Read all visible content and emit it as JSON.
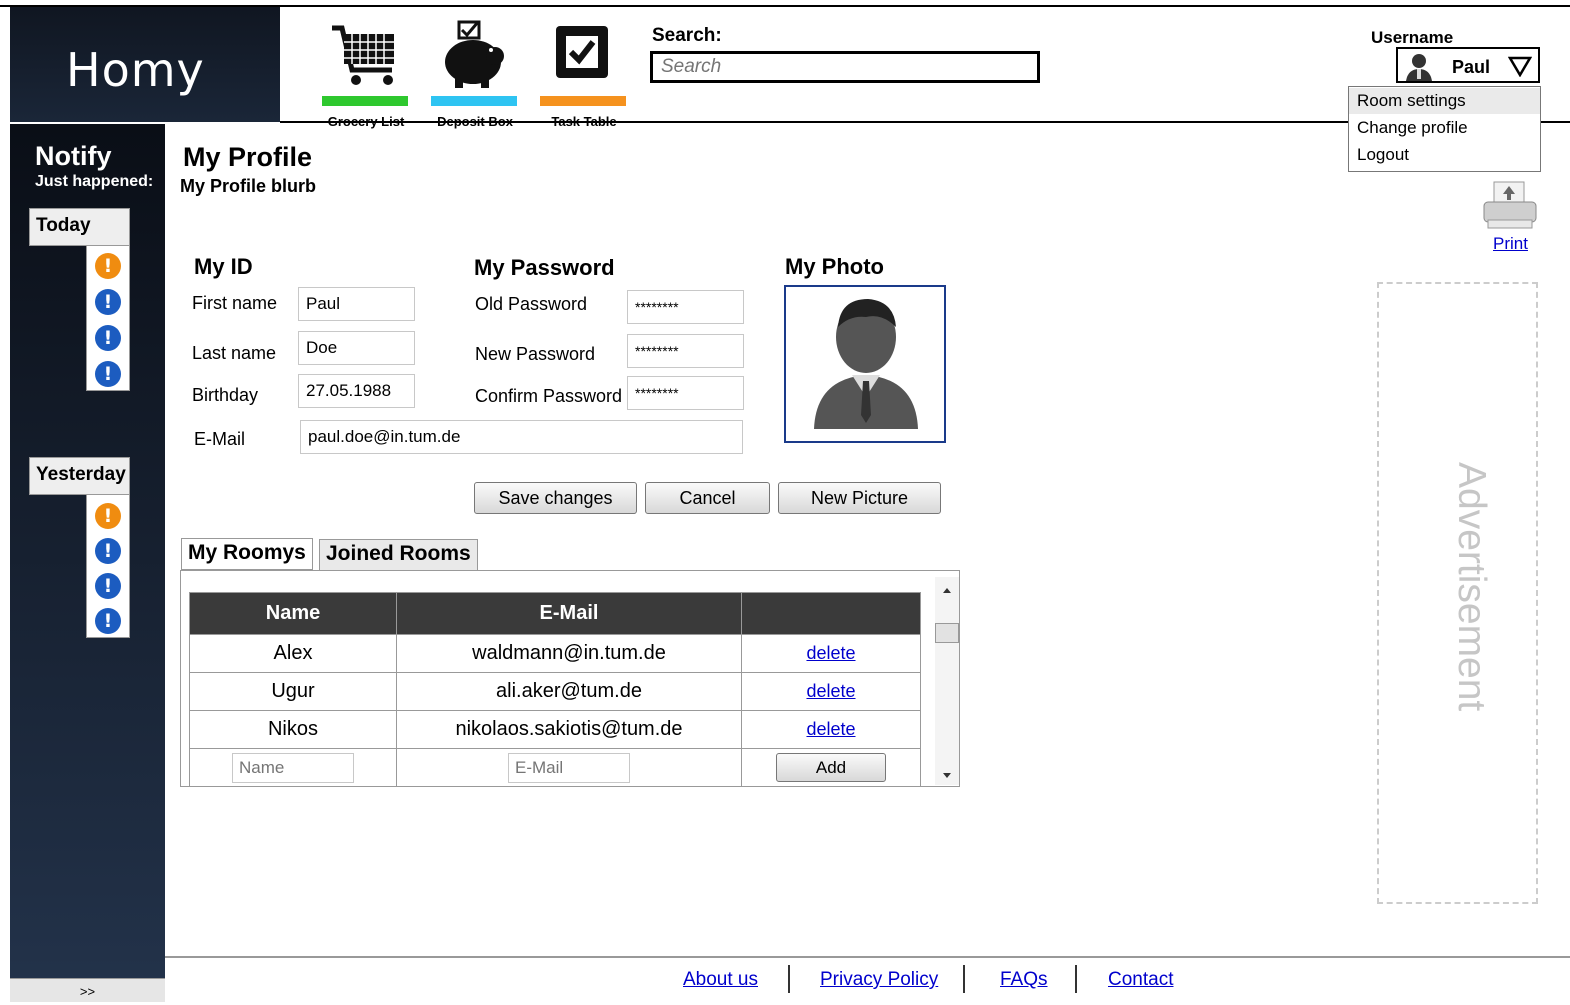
{
  "app": {
    "logo": "Homy"
  },
  "nav": [
    {
      "label": "Grocery List",
      "icon": "shopping-cart-icon",
      "color": "#2ec82e"
    },
    {
      "label": "Deposit Box",
      "icon": "piggy-bank-icon",
      "color": "#2ec4f2"
    },
    {
      "label": "Task Table",
      "icon": "checkbox-icon",
      "color": "#f5921e"
    }
  ],
  "search": {
    "label": "Search:",
    "placeholder": "Search"
  },
  "user": {
    "label": "Username",
    "name": "Paul",
    "menu": [
      "Room settings",
      "Change profile",
      "Logout"
    ]
  },
  "sidebar": {
    "title": "Notify",
    "subtitle": "Just happened:",
    "groups": [
      {
        "label": "Today",
        "items": [
          "warning",
          "info",
          "info",
          "info"
        ]
      },
      {
        "label": "Yesterday",
        "items": [
          "warning",
          "info",
          "info",
          "info"
        ]
      }
    ],
    "expand_label": ">>"
  },
  "page": {
    "title": "My Profile",
    "blurb": "My Profile blurb"
  },
  "profile": {
    "id_title": "My ID",
    "first_name_label": "First name",
    "first_name": "Paul",
    "last_name_label": "Last name",
    "last_name": "Doe",
    "birthday_label": "Birthday",
    "birthday": "27.05.1988",
    "email_label": "E-Mail",
    "email": "paul.doe@in.tum.de"
  },
  "password": {
    "title": "My Password",
    "old_label": "Old Password",
    "old": "********",
    "new_label": "New Password",
    "new": "********",
    "confirm_label": "Confirm Password",
    "confirm": "********"
  },
  "photo": {
    "title": "My Photo"
  },
  "buttons": {
    "save": "Save changes",
    "cancel": "Cancel",
    "new_picture": "New Picture"
  },
  "tabs": [
    "My Roomys",
    "Joined Rooms"
  ],
  "roomys": {
    "columns": [
      "Name",
      "E-Mail",
      ""
    ],
    "rows": [
      {
        "name": "Alex",
        "email": "waldmann@in.tum.de",
        "action": "delete"
      },
      {
        "name": "Ugur",
        "email": "ali.aker@tum.de",
        "action": "delete"
      },
      {
        "name": "Nikos",
        "email": "nikolaos.sakiotis@tum.de",
        "action": "delete"
      }
    ],
    "new_name_placeholder": "Name",
    "new_email_placeholder": "E-Mail",
    "add_label": "Add"
  },
  "print": {
    "label": "Print"
  },
  "ad": {
    "label": "Advertisement"
  },
  "footer": {
    "links": [
      "About us",
      "Privacy Policy",
      "FAQs",
      "Contact"
    ]
  }
}
